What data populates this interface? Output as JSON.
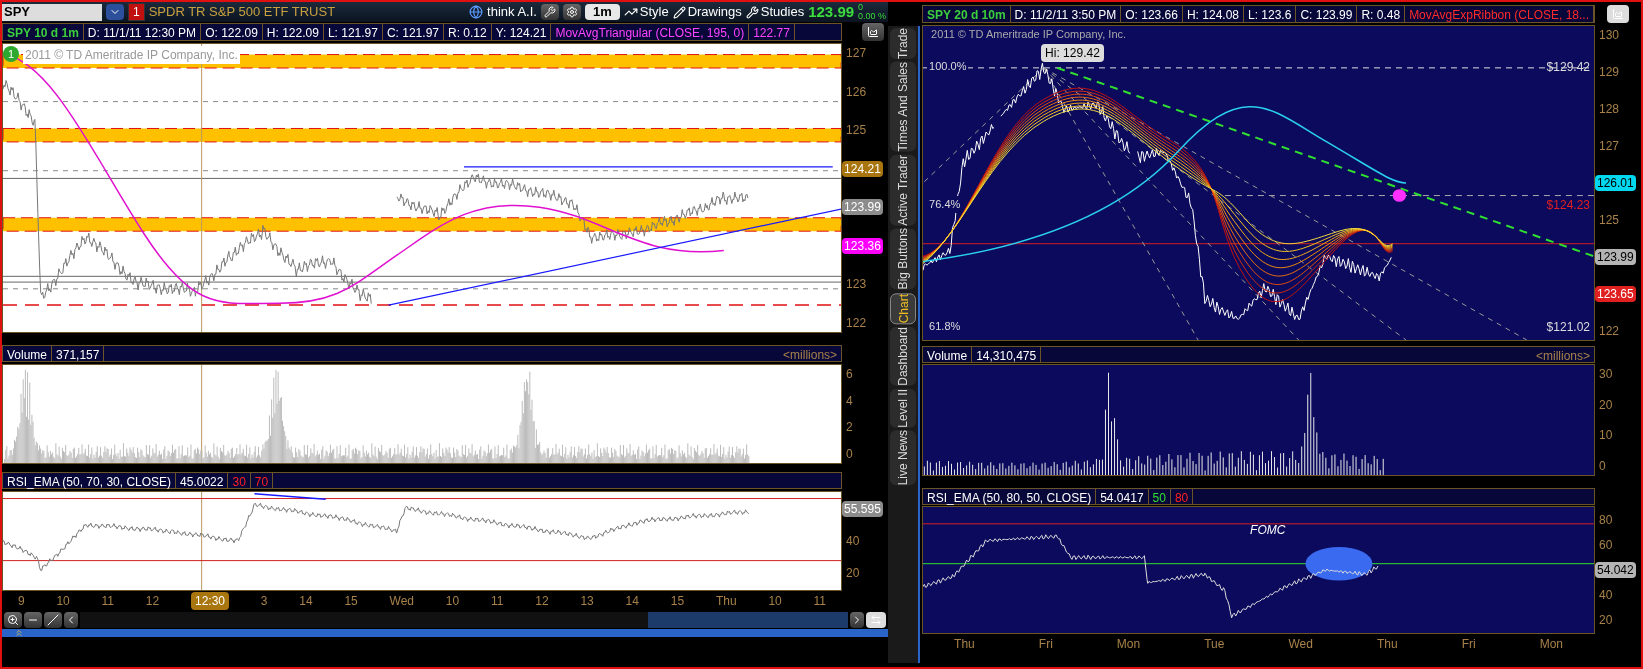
{
  "toolbar": {
    "symbol": "SPY",
    "alert_badge": "1",
    "description": "SPDR TR S&P 500 ETF TRUST",
    "ai_button": "think A.I.",
    "interval": "1m",
    "style": "Style",
    "drawings": "Drawings",
    "studies": "Studies",
    "last_price": "123.99",
    "change": "0",
    "change_pct": "0.00 %"
  },
  "left_chart": {
    "title": "SPY 10 d 1m",
    "fields": [
      "D: 11/1/11 12:30 PM",
      "O: 122.09",
      "H: 122.09",
      "L: 121.97",
      "C: 121.97",
      "R: 0.12",
      "Y: 124.21"
    ],
    "study": "MovAvgTriangular (CLOSE, 195, 0)",
    "study_value": "122.77",
    "marker": "1",
    "watermark": "2011 © TD Ameritrade IP Company, Inc.",
    "price_axis": [
      {
        "kind": "tick",
        "text": "127"
      },
      {
        "kind": "tick",
        "text": "126"
      },
      {
        "kind": "tick",
        "text": "125"
      },
      {
        "kind": "badge",
        "text": "124.21",
        "color": "#a8750e"
      },
      {
        "kind": "badge",
        "text": "123.99",
        "color": "#8c8c8c"
      },
      {
        "kind": "badge",
        "text": "123.36",
        "color": "#ff00ff"
      },
      {
        "kind": "tick",
        "text": "123"
      },
      {
        "kind": "tick",
        "text": "122"
      }
    ],
    "volume": {
      "label": "Volume",
      "value": "371,157",
      "units": "<millions>",
      "axis": [
        {
          "kind": "tick",
          "text": "6"
        },
        {
          "kind": "tick",
          "text": "4"
        },
        {
          "kind": "tick",
          "text": "2"
        },
        {
          "kind": "tick",
          "text": "0"
        }
      ]
    },
    "rsi": {
      "label": "RSI_EMA (50, 70, 30, CLOSE)",
      "value": "45.0022",
      "levels": [
        {
          "text": "30",
          "kind": "limit"
        },
        {
          "text": "70",
          "kind": "limit"
        }
      ],
      "axis": [
        {
          "kind": "badge",
          "text": "55.595",
          "color": "#8c8c8c"
        },
        {
          "kind": "tick",
          "text": "40"
        },
        {
          "kind": "tick",
          "text": "20"
        }
      ]
    },
    "time_axis": [
      {
        "kind": "tick",
        "text": "9"
      },
      {
        "kind": "tick",
        "text": "10"
      },
      {
        "kind": "tick",
        "text": "11"
      },
      {
        "kind": "tick",
        "text": "12"
      },
      {
        "kind": "cursor",
        "text": "12:30"
      },
      {
        "kind": "tick",
        "text": "3"
      },
      {
        "kind": "tick",
        "text": "14"
      },
      {
        "kind": "tick",
        "text": "15"
      },
      {
        "kind": "tick",
        "text": "Wed"
      },
      {
        "kind": "tick",
        "text": "10"
      },
      {
        "kind": "tick",
        "text": "11"
      },
      {
        "kind": "tick",
        "text": "12"
      },
      {
        "kind": "tick",
        "text": "13"
      },
      {
        "kind": "tick",
        "text": "14"
      },
      {
        "kind": "tick",
        "text": "15"
      },
      {
        "kind": "tick",
        "text": "Thu"
      },
      {
        "kind": "tick",
        "text": "10"
      },
      {
        "kind": "tick",
        "text": "11"
      }
    ]
  },
  "side_tabs": [
    {
      "label": "Trade",
      "selected": false
    },
    {
      "label": "Times And Sales",
      "selected": false
    },
    {
      "label": "Active Trader",
      "selected": false
    },
    {
      "label": "Big Buttons",
      "selected": false
    },
    {
      "label": "Chart",
      "selected": true
    },
    {
      "label": "Dashboard",
      "selected": false
    },
    {
      "label": "Level II",
      "selected": false
    },
    {
      "label": "Live News",
      "selected": false
    }
  ],
  "right_chart": {
    "title": "SPY 20 d 10m",
    "fields": [
      "D: 11/2/11 3:50 PM",
      "O: 123.66",
      "H: 124.08",
      "L: 123.6",
      "C: 123.99",
      "R: 0.48"
    ],
    "study": "MovAvgExpRibbon (CLOSE, 18...",
    "watermark": "2011 © TD Ameritrade IP Company, Inc.",
    "hi_label": "Hi: 129.42",
    "fib_levels": [
      {
        "percent": "100.0%",
        "price": "$129.42"
      },
      {
        "percent": "76.4%",
        "price": "$124.23"
      },
      {
        "percent": "61.8%",
        "price": "$121.02"
      }
    ],
    "price_axis": [
      {
        "kind": "tick",
        "text": "130"
      },
      {
        "kind": "tick",
        "text": "129"
      },
      {
        "kind": "tick",
        "text": "128"
      },
      {
        "kind": "tick",
        "text": "127"
      },
      {
        "kind": "badge",
        "text": "126.01",
        "color": "#00d8f0"
      },
      {
        "kind": "tick",
        "text": "125"
      },
      {
        "kind": "badge",
        "text": "123.99",
        "color": "#b4b4b4"
      },
      {
        "kind": "badge",
        "text": "123.65",
        "color": "#e02020"
      },
      {
        "kind": "tick",
        "text": "122"
      }
    ],
    "volume": {
      "label": "Volume",
      "value": "14,310,475",
      "units": "<millions>",
      "axis": [
        {
          "kind": "tick",
          "text": "30"
        },
        {
          "kind": "tick",
          "text": "20"
        },
        {
          "kind": "tick",
          "text": "10"
        },
        {
          "kind": "tick",
          "text": "0"
        }
      ]
    },
    "rsi": {
      "label": "RSI_EMA (50, 80, 50, CLOSE)",
      "value": "54.0417",
      "levels": [
        {
          "text": "50",
          "kind": "midline"
        },
        {
          "text": "80",
          "kind": "limit"
        }
      ],
      "annotation": "FOMC",
      "axis": [
        {
          "kind": "tick",
          "text": "80"
        },
        {
          "kind": "tick",
          "text": "60"
        },
        {
          "kind": "badge",
          "text": "54.042",
          "color": "#b4b4b4"
        },
        {
          "kind": "tick",
          "text": "40"
        },
        {
          "kind": "tick",
          "text": "20"
        }
      ]
    },
    "time_axis": [
      {
        "kind": "tick",
        "text": "Thu"
      },
      {
        "kind": "tick",
        "text": "Fri"
      },
      {
        "kind": "tick",
        "text": "Mon"
      },
      {
        "kind": "tick",
        "text": "Tue"
      },
      {
        "kind": "tick",
        "text": "Wed"
      },
      {
        "kind": "tick",
        "text": "Thu"
      },
      {
        "kind": "tick",
        "text": "Fri"
      },
      {
        "kind": "tick",
        "text": "Mon"
      }
    ]
  }
}
